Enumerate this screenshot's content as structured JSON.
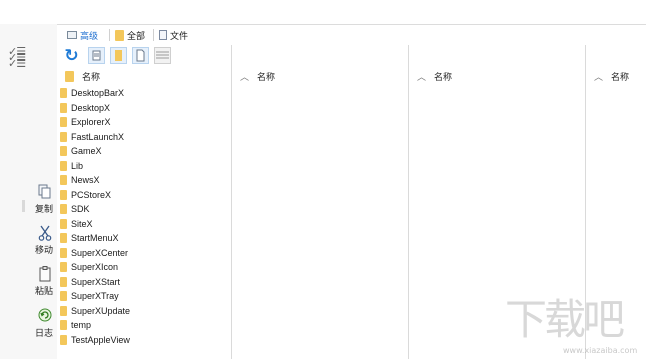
{
  "tabs": [
    {
      "label": "高级",
      "icon": "window-icon"
    },
    {
      "label": "全部",
      "icon": "folder-icon"
    },
    {
      "label": "文件",
      "icon": "document-icon"
    }
  ],
  "commands": [
    {
      "label": "复制",
      "icon": "copy-icon"
    },
    {
      "label": "移动",
      "icon": "scissors-icon"
    },
    {
      "label": "粘贴",
      "icon": "clipboard-icon"
    },
    {
      "label": "日志",
      "icon": "log-icon"
    }
  ],
  "toolbar": [
    "refresh-icon",
    "grid-view-icon",
    "folder-view-icon",
    "file-view-icon",
    "list-view-icon"
  ],
  "panes": [
    {
      "header": "名称"
    },
    {
      "header": "名称"
    },
    {
      "header": "名称"
    },
    {
      "header": "名称"
    }
  ],
  "files": [
    "DesktopBarX",
    "DesktopX",
    "ExplorerX",
    "FastLaunchX",
    "GameX",
    "Lib",
    "NewsX",
    "PCStoreX",
    "SDK",
    "SiteX",
    "StartMenuX",
    "SuperXCenter",
    "SuperXIcon",
    "SuperXStart",
    "SuperXTray",
    "SuperXUpdate",
    "temp",
    "TestAppleView"
  ],
  "watermark": {
    "big": "下载吧",
    "url": "www.xiazaiba.com"
  },
  "colors": {
    "accent": "#1e6fd0",
    "folder": "#f3c75b"
  }
}
